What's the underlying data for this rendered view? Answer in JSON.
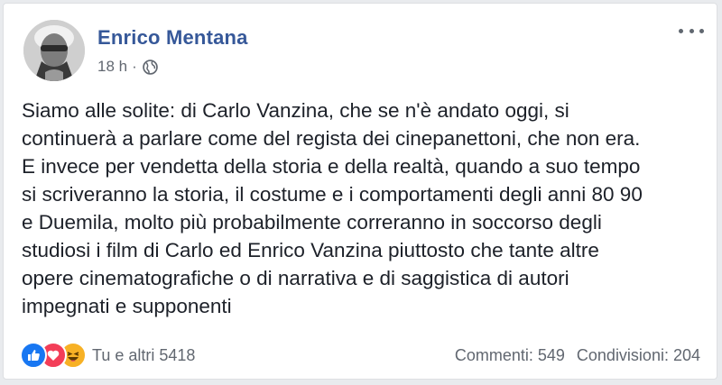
{
  "post": {
    "author": "Enrico Mentana",
    "time": "18 h",
    "separator": "·",
    "audience_icon": "globe-icon",
    "more_icon": "ellipsis-icon",
    "text_lines": [
      "Siamo alle solite: di Carlo Vanzina, che se n'è andato oggi, si",
      "continuerà a parlare come del regista dei cinepanettoni, che non era.",
      "E invece per vendetta della storia e della realtà, quando a suo tempo",
      "si scriveranno la storia, il costume e i comportamenti degli anni 80 90",
      "e Duemila, molto più probabilmente correranno in soccorso degli",
      "studiosi i film di Carlo ed Enrico Vanzina piuttosto che tante altre",
      "opere cinematografiche o di narrativa e di saggistica di autori",
      "impegnati e supponenti"
    ]
  },
  "footer": {
    "reaction_icons": [
      "like-icon",
      "love-icon",
      "haha-icon"
    ],
    "reactions_label": "Tu e altri 5418",
    "comments": "Commenti: 549",
    "shares": "Condivisioni: 204"
  },
  "colors": {
    "author_link": "#365899",
    "meta_text": "#616770",
    "body_text": "#1d2129",
    "like": "#1877f2",
    "love": "#f33e58",
    "haha": "#f7b125"
  }
}
